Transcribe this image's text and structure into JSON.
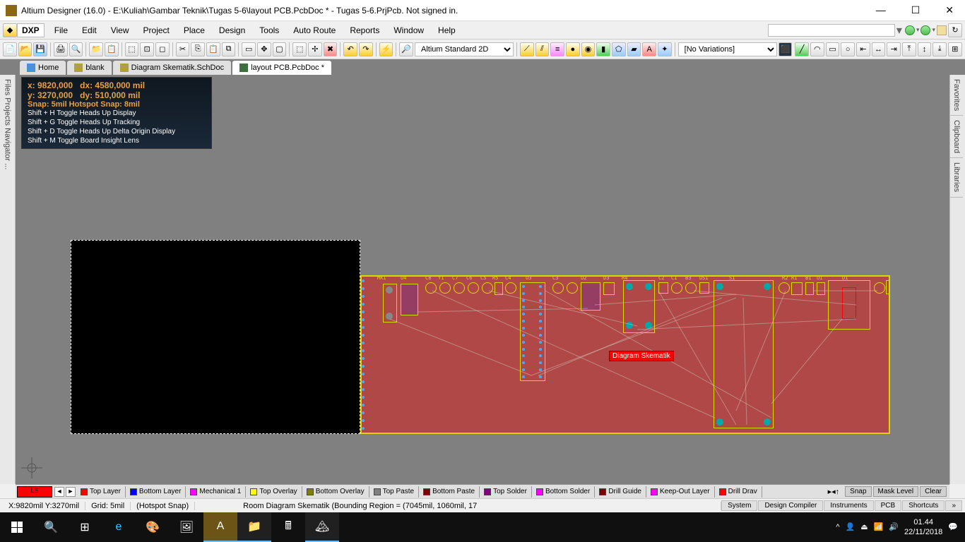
{
  "title": "Altium Designer (16.0) - E:\\Kuliah\\Gambar Teknik\\Tugas 5-6\\layout PCB.PcbDoc * - Tugas 5-6.PrjPcb. Not signed in.",
  "menu": {
    "dxp": "DXP",
    "items": [
      "File",
      "Edit",
      "View",
      "Project",
      "Place",
      "Design",
      "Tools",
      "Auto Route",
      "Reports",
      "Window",
      "Help"
    ]
  },
  "toolbar2": {
    "viewmode": "Altium Standard 2D",
    "variations": "[No Variations]"
  },
  "doctabs": [
    {
      "label": "Home",
      "icon": "home",
      "active": false
    },
    {
      "label": "blank",
      "icon": "sch",
      "active": false
    },
    {
      "label": "Diagram Skematik.SchDoc",
      "icon": "sch",
      "active": false
    },
    {
      "label": "layout PCB.PcbDoc *",
      "icon": "pcb",
      "active": true
    }
  ],
  "leftpanel": "Files  Projects  Navigator ...",
  "rightpanels": [
    "Favorites",
    "Clipboard",
    "Libraries"
  ],
  "hud": {
    "x": "x:  9820,000",
    "dx": "dx:  4580,000 mil",
    "y": "y:  3270,000",
    "dy": "dy:   510,000  mil",
    "snap": "Snap: 5mil Hotspot Snap: 8mil",
    "h": "Shift + H  Toggle Heads Up Display",
    "g": "Shift + G  Toggle Heads Up Tracking",
    "d": "Shift + D  Toggle Heads Up Delta Origin Display",
    "m": "Shift + M Toggle Board Insight Lens"
  },
  "room_label": "Diagram Skematik",
  "designators": [
    "MK1",
    "U4",
    "C8",
    "Y1",
    "C7",
    "C6",
    "C5",
    "R5",
    "C4",
    "U3",
    "C3",
    "U2",
    "D3",
    "R4",
    "C2",
    "C1",
    "B3",
    "DS1",
    "S1",
    "R2",
    "R1",
    "B1",
    "U1",
    "D1"
  ],
  "layers": {
    "current": "LS",
    "tabs": [
      {
        "name": "Top Layer",
        "color": "#ff0000"
      },
      {
        "name": "Bottom Layer",
        "color": "#0000ff"
      },
      {
        "name": "Mechanical 1",
        "color": "#ff00ff"
      },
      {
        "name": "Top Overlay",
        "color": "#ffff00"
      },
      {
        "name": "Bottom Overlay",
        "color": "#808000"
      },
      {
        "name": "Top Paste",
        "color": "#808080"
      },
      {
        "name": "Bottom Paste",
        "color": "#800000"
      },
      {
        "name": "Top Solder",
        "color": "#800080"
      },
      {
        "name": "Bottom Solder",
        "color": "#ff00ff"
      },
      {
        "name": "Drill Guide",
        "color": "#800000"
      },
      {
        "name": "Keep-Out Layer",
        "color": "#ff00ff"
      },
      {
        "name": "Drill Drav",
        "color": "#ff0000"
      }
    ],
    "buttons": [
      "Snap",
      "Mask Level",
      "Clear"
    ]
  },
  "status": {
    "pos": "X:9820mil Y:3270mil",
    "grid": "Grid: 5mil",
    "hotspot": "(Hotspot Snap)",
    "msg": "Room Diagram Skematik (Bounding Region = (7045mil, 1060mil, 17",
    "buttons": [
      "System",
      "Design Compiler",
      "Instruments",
      "PCB",
      "Shortcuts"
    ]
  },
  "tray": {
    "time": "01.44",
    "date": "22/11/2018"
  }
}
